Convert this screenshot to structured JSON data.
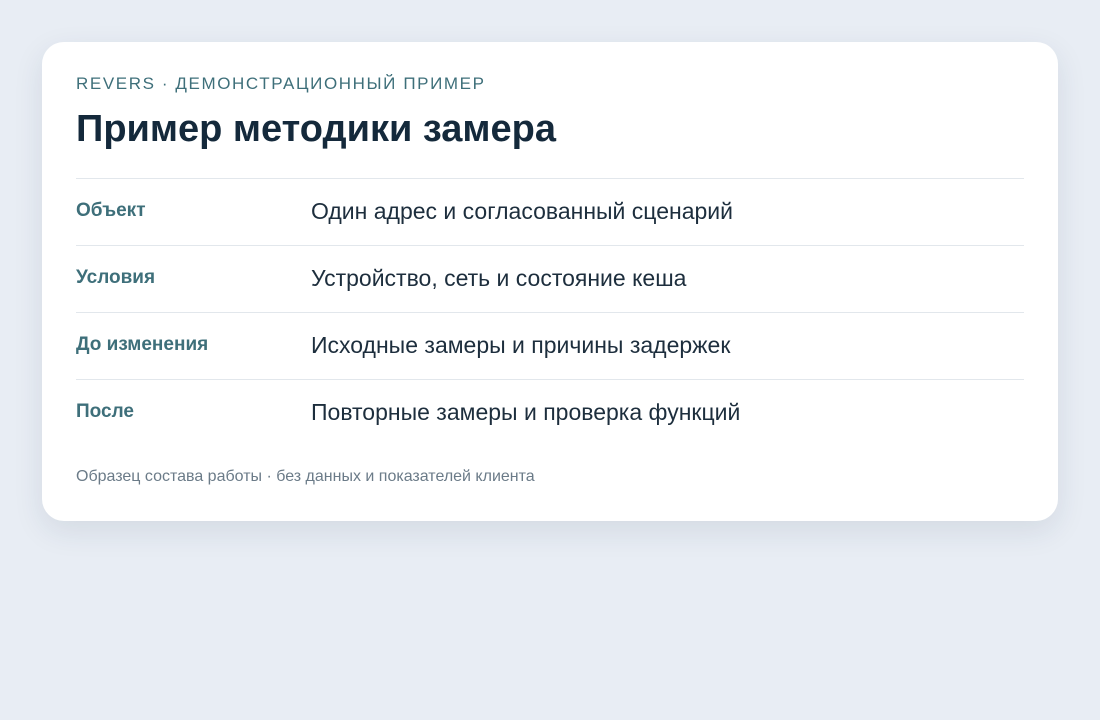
{
  "card": {
    "eyebrow": "REVERS · ДЕМОНСТРАЦИОННЫЙ ПРИМЕР",
    "title": "Пример методики замера",
    "rows": [
      {
        "label": "Объект",
        "value": "Один адрес и согласованный сценарий"
      },
      {
        "label": "Условия",
        "value": "Устройство, сеть и состояние кеша"
      },
      {
        "label": "До изменения",
        "value": "Исходные замеры и причины задержек"
      },
      {
        "label": "После",
        "value": "Повторные замеры и проверка функций"
      }
    ],
    "footnote": "Образец состава работы · без данных и показателей клиента"
  },
  "colors": {
    "background": "#e8edf4",
    "card": "#ffffff",
    "accent": "#3e6f7a",
    "title": "#14293b",
    "text": "#1d2e3d",
    "muted": "#6b7b88"
  }
}
